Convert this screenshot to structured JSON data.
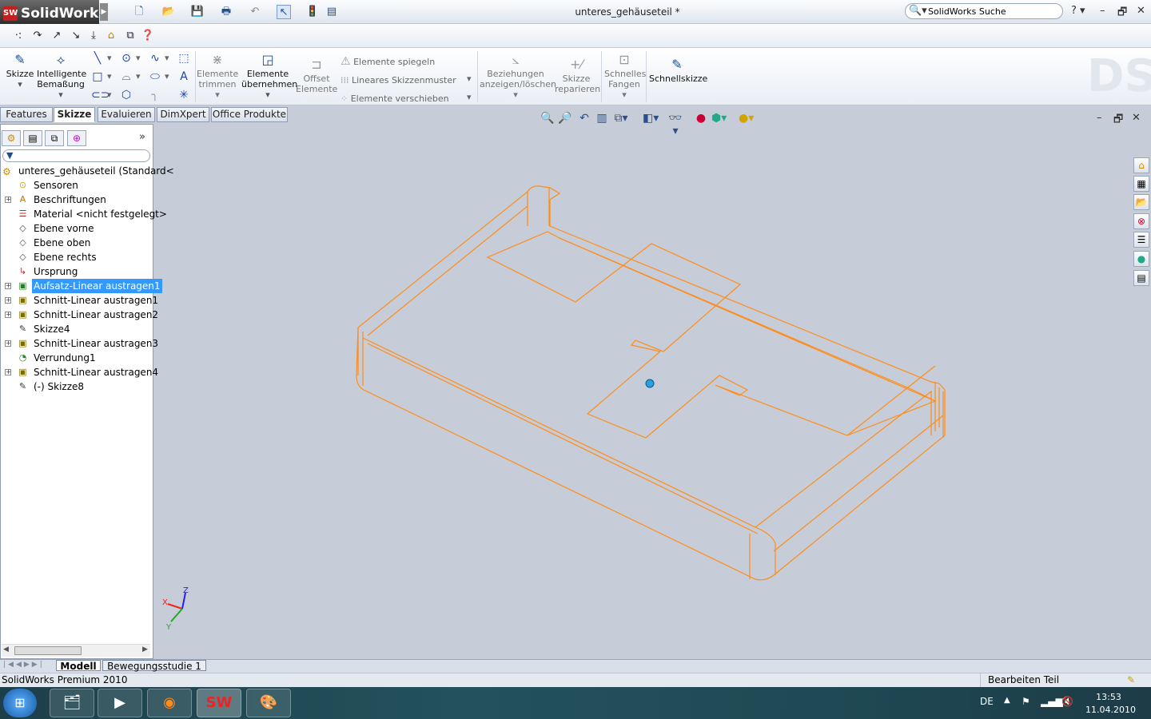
{
  "app": {
    "name": "SolidWorks",
    "document_title": "unteres_gehäuseteil *"
  },
  "search": {
    "placeholder": "SolidWorks Suche"
  },
  "command_manager": {
    "skizze": "Skizze",
    "intelligente_bemassung": [
      "Intelligente",
      "Bemaßung"
    ],
    "elemente_trimmen": [
      "Elemente",
      "trimmen"
    ],
    "elemente_uebernehmen": [
      "Elemente",
      "übernehmen"
    ],
    "offset_elemente": [
      "Offset",
      "Elemente"
    ],
    "elemente_spiegeln": "Elemente spiegeln",
    "lineares_skizzenmuster": "Lineares Skizzenmuster",
    "elemente_verschieben": "Elemente verschieben",
    "beziehungen": [
      "Beziehungen",
      "anzeigen/löschen"
    ],
    "skizze_reparieren": [
      "Skizze",
      "reparieren"
    ],
    "schnelles_fangen": [
      "Schnelles",
      "Fangen"
    ],
    "schnellskizze": "Schnellskizze"
  },
  "tabs": [
    "Features",
    "Skizze",
    "Evaluieren",
    "DimXpert",
    "Office Produkte"
  ],
  "active_tab": "Skizze",
  "tree": {
    "root": "unteres_gehäuseteil  (Standard<",
    "items": [
      {
        "label": "Sensoren",
        "icon": "sensor-icon",
        "expandable": false
      },
      {
        "label": "Beschriftungen",
        "icon": "annotation-icon",
        "expandable": true
      },
      {
        "label": "Material <nicht festgelegt>",
        "icon": "material-icon",
        "expandable": false
      },
      {
        "label": "Ebene vorne",
        "icon": "plane-icon",
        "expandable": false
      },
      {
        "label": "Ebene oben",
        "icon": "plane-icon",
        "expandable": false
      },
      {
        "label": "Ebene rechts",
        "icon": "plane-icon",
        "expandable": false
      },
      {
        "label": "Ursprung",
        "icon": "origin-icon",
        "expandable": false
      },
      {
        "label": "Aufsatz-Linear austragen1",
        "icon": "extrude-icon",
        "expandable": true,
        "selected": true
      },
      {
        "label": "Schnitt-Linear austragen1",
        "icon": "cut-extrude-icon",
        "expandable": true
      },
      {
        "label": "Schnitt-Linear austragen2",
        "icon": "cut-extrude-icon",
        "expandable": true
      },
      {
        "label": "Skizze4",
        "icon": "sketch-icon",
        "expandable": false
      },
      {
        "label": "Schnitt-Linear austragen3",
        "icon": "cut-extrude-icon",
        "expandable": true
      },
      {
        "label": "Verrundung1",
        "icon": "fillet-icon",
        "expandable": false
      },
      {
        "label": "Schnitt-Linear austragen4",
        "icon": "cut-extrude-icon",
        "expandable": true
      },
      {
        "label": "(-) Skizze8",
        "icon": "sketch-icon",
        "expandable": false
      }
    ]
  },
  "bottom_tabs": [
    "Modell",
    "Bewegungsstudie 1"
  ],
  "status": {
    "left": "SolidWorks Premium 2010",
    "right": "Bearbeiten Teil"
  },
  "taskbar": {
    "lang": "DE",
    "time": "13:53",
    "date": "11.04.2010"
  },
  "triad": {
    "x": "X",
    "y": "Y",
    "z": "Z"
  },
  "colors": {
    "model_edges": "#ff8c1a",
    "viewport_bg": "#c6cdd8",
    "selection": "#3399ff"
  }
}
